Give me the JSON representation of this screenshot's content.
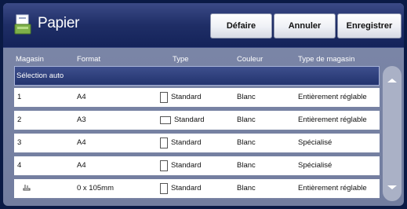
{
  "header": {
    "title": "Papier",
    "icon": "paper-tray-icon",
    "buttons": {
      "undo": "Défaire",
      "cancel": "Annuler",
      "save": "Enregistrer"
    }
  },
  "columns": {
    "tray": "Magasin",
    "format": "Format",
    "type": "Type",
    "color": "Couleur",
    "tray_type": "Type de magasin"
  },
  "rows": [
    {
      "tray": "Sélection auto",
      "format": "",
      "type": "",
      "color": "",
      "tray_type": "",
      "selected": true
    },
    {
      "tray": "1",
      "format": "A4",
      "type": "Standard",
      "orientation": "portrait",
      "color": "Blanc",
      "tray_type": "Entièrement réglable"
    },
    {
      "tray": "2",
      "format": "A3",
      "type": "Standard",
      "orientation": "landscape",
      "color": "Blanc",
      "tray_type": "Entièrement réglable"
    },
    {
      "tray": "3",
      "format": "A4",
      "type": "Standard",
      "orientation": "portrait",
      "color": "Blanc",
      "tray_type": "Spécialisé"
    },
    {
      "tray": "4",
      "format": "A4",
      "type": "Standard",
      "orientation": "portrait",
      "color": "Blanc",
      "tray_type": "Spécialisé"
    },
    {
      "tray": "",
      "tray_icon": "bypass-tray-icon",
      "format": "0 x 105mm",
      "type": "Standard",
      "orientation": "portrait",
      "color": "Blanc",
      "tray_type": "Entièrement réglable"
    }
  ],
  "colors": {
    "selected_row": "#2a3a78",
    "title_bar": "#1f2e66",
    "panel": "#7a85a6"
  }
}
